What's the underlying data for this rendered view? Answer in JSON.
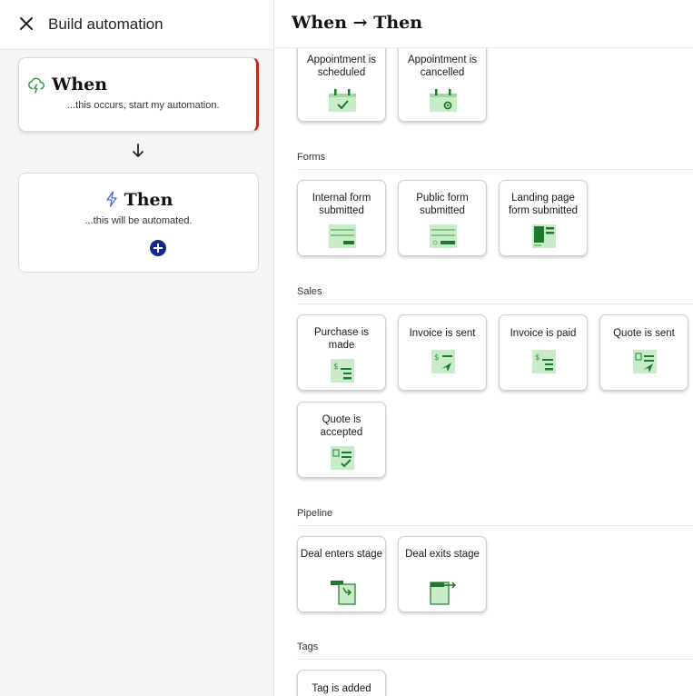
{
  "left_panel": {
    "title": "Build automation",
    "when": {
      "title": "When",
      "subtitle": "...this occurs, start my automation."
    },
    "then": {
      "title": "Then",
      "subtitle": "...this will be automated."
    }
  },
  "right_panel": {
    "title": "When → Then",
    "appointments": {
      "tiles": [
        {
          "label": "Appointment is scheduled",
          "icon": "calendar-check-icon"
        },
        {
          "label": "Appointment is cancelled",
          "icon": "calendar-cancel-icon"
        }
      ]
    },
    "forms": {
      "label": "Forms",
      "tiles": [
        {
          "label": "Internal form submitted",
          "icon": "internal-form-icon"
        },
        {
          "label": "Public form submitted",
          "icon": "public-form-icon"
        },
        {
          "label": "Landing page form submitted",
          "icon": "landing-page-form-icon"
        }
      ]
    },
    "sales": {
      "label": "Sales",
      "tiles": [
        {
          "label": "Purchase is made",
          "icon": "purchase-icon"
        },
        {
          "label": "Invoice is sent",
          "icon": "invoice-sent-icon"
        },
        {
          "label": "Invoice is paid",
          "icon": "invoice-paid-icon"
        },
        {
          "label": "Quote is sent",
          "icon": "quote-sent-icon"
        },
        {
          "label": "Quote is accepted",
          "icon": "quote-accepted-icon"
        }
      ]
    },
    "pipeline": {
      "label": "Pipeline",
      "tiles": [
        {
          "label": "Deal enters stage",
          "icon": "deal-enters-stage-icon"
        },
        {
          "label": "Deal exits stage",
          "icon": "deal-exits-stage-icon"
        }
      ]
    },
    "tags": {
      "label": "Tags",
      "tiles": [
        {
          "label": "Tag is added",
          "icon": "tag-added-icon"
        }
      ]
    }
  },
  "colors": {
    "accent_red": "#c1281d",
    "add_button_navy": "#142a8a",
    "icon_green_light": "#c9ebc9",
    "icon_green_dark": "#1d7a2c"
  }
}
